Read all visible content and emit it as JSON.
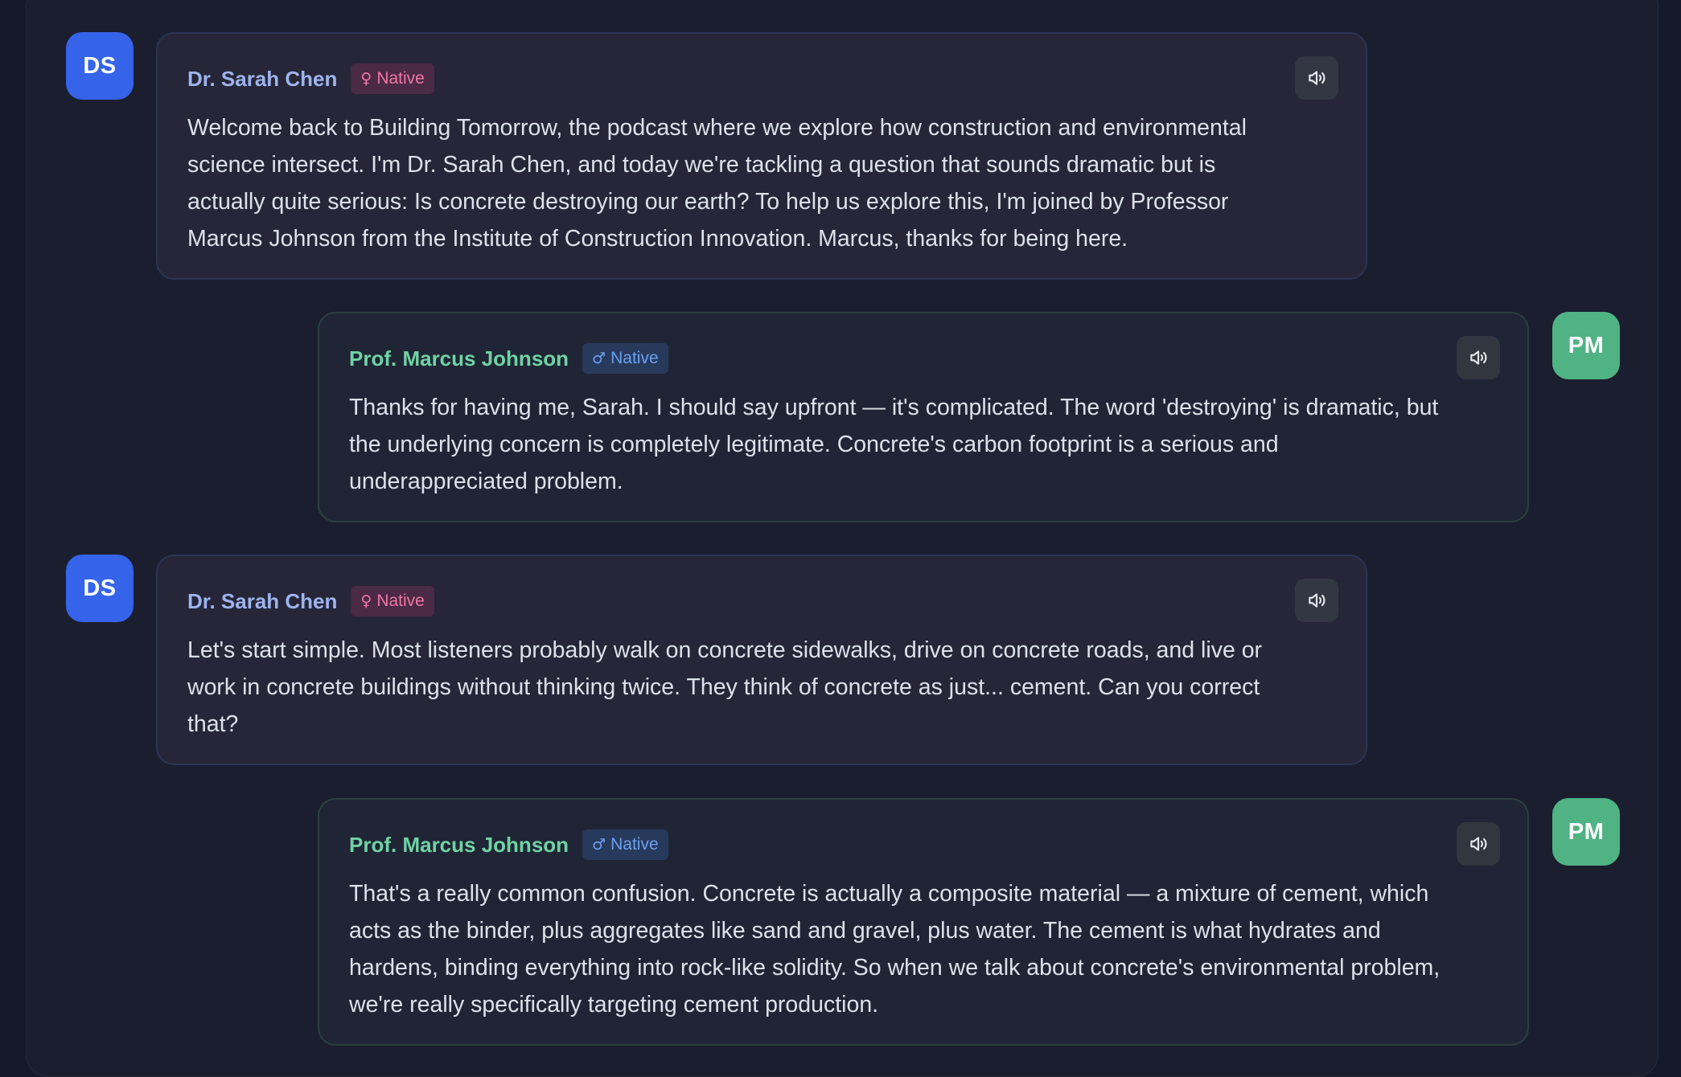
{
  "messages": [
    {
      "role": "host",
      "initials": "DS",
      "speaker": "Dr. Sarah Chen",
      "badge_symbol": "♀",
      "badge_label": "Native",
      "text": "Welcome back to Building Tomorrow, the podcast where we explore how construction and environmental science intersect. I'm Dr. Sarah Chen, and today we're tackling a question that sounds dramatic but is actually quite serious: Is concrete destroying our earth? To help us explore this, I'm joined by Professor Marcus Johnson from the Institute of Construction Innovation. Marcus, thanks for being here."
    },
    {
      "role": "guest",
      "initials": "PM",
      "speaker": "Prof. Marcus Johnson",
      "badge_symbol": "♂",
      "badge_label": "Native",
      "text": "Thanks for having me, Sarah. I should say upfront — it's complicated. The word 'destroying' is dramatic, but the underlying concern is completely legitimate. Concrete's carbon footprint is a serious and underappreciated problem."
    },
    {
      "role": "host",
      "initials": "DS",
      "speaker": "Dr. Sarah Chen",
      "badge_symbol": "♀",
      "badge_label": "Native",
      "text": "Let's start simple. Most listeners probably walk on concrete sidewalks, drive on concrete roads, and live or work in concrete buildings without thinking twice. They think of concrete as just... cement. Can you correct that?"
    },
    {
      "role": "guest",
      "initials": "PM",
      "speaker": "Prof. Marcus Johnson",
      "badge_symbol": "♂",
      "badge_label": "Native",
      "text": "That's a really common confusion. Concrete is actually a composite material — a mixture of cement, which acts as the binder, plus aggregates like sand and gravel, plus water. The cement is what hydrates and hardens, binding everything into rock-like solidity. So when we talk about concrete's environmental problem, we're really specifically targeting cement production."
    }
  ],
  "icons": {
    "play_audio": "speaker-volume-icon"
  },
  "colors": {
    "host_avatar": "#3563e9",
    "guest_avatar": "#4fb384",
    "host_name": "#9db4ee",
    "guest_name": "#6fd3a3",
    "female_badge": "#f076a8",
    "male_badge": "#6aa0ee"
  }
}
